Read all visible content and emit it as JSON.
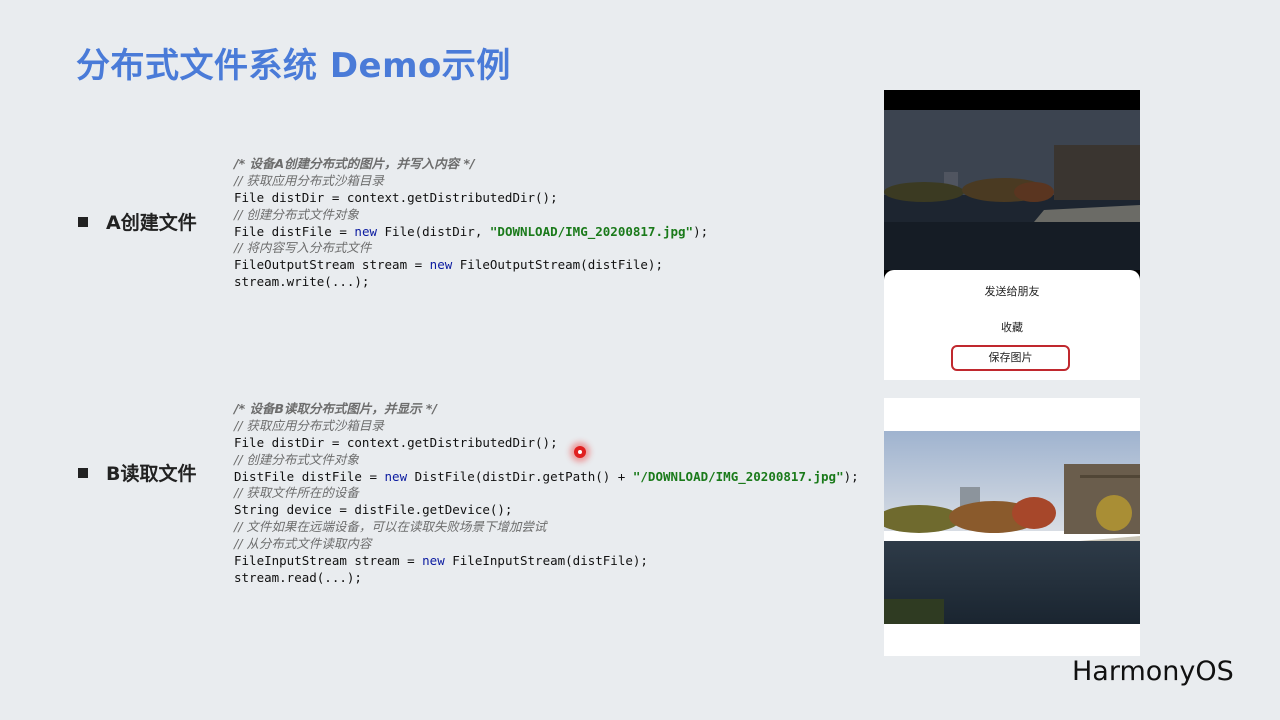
{
  "slide": {
    "title": "分布式文件系统 Demo示例",
    "logo": "HarmonyOS"
  },
  "section_a": {
    "label": "A创建文件",
    "code": [
      {
        "type": "comment-bold",
        "text": "/* 设备A创建分布式的图片，并写入内容 */"
      },
      {
        "type": "comment",
        "text": "// 获取应用分布式沙箱目录"
      },
      {
        "type": "code",
        "parts": [
          {
            "t": "File distDir = context.getDistributedDir();"
          }
        ]
      },
      {
        "type": "comment",
        "text": "// 创建分布式文件对象"
      },
      {
        "type": "code",
        "parts": [
          {
            "t": "File distFile = "
          },
          {
            "t": "new",
            "k": "kw"
          },
          {
            "t": " File(distDir, "
          },
          {
            "t": "\"DOWNLOAD/IMG_20200817.jpg\"",
            "k": "str"
          },
          {
            "t": ");"
          }
        ]
      },
      {
        "type": "comment",
        "text": "// 将内容写入分布式文件"
      },
      {
        "type": "code",
        "parts": [
          {
            "t": "FileOutputStream stream = "
          },
          {
            "t": "new",
            "k": "kw"
          },
          {
            "t": " FileOutputStream(distFile);"
          }
        ]
      },
      {
        "type": "code",
        "parts": [
          {
            "t": "stream.write(...);"
          }
        ]
      }
    ]
  },
  "section_b": {
    "label": "B读取文件",
    "code": [
      {
        "type": "comment-bold",
        "text": "/* 设备B读取分布式图片，并显示 */"
      },
      {
        "type": "comment",
        "text": "// 获取应用分布式沙箱目录"
      },
      {
        "type": "code",
        "parts": [
          {
            "t": "File distDir = context.getDistributedDir();"
          }
        ]
      },
      {
        "type": "comment",
        "text": "// 创建分布式文件对象"
      },
      {
        "type": "code",
        "parts": [
          {
            "t": "DistFile distFile = "
          },
          {
            "t": "new",
            "k": "kw"
          },
          {
            "t": " DistFile(distDir.getPath() + "
          },
          {
            "t": "\"/DOWNLOAD/IMG_20200817.jpg\"",
            "k": "str"
          },
          {
            "t": ");"
          }
        ]
      },
      {
        "type": "comment",
        "text": "// 获取文件所在的设备"
      },
      {
        "type": "code",
        "parts": [
          {
            "t": "String device = distFile.getDevice();"
          }
        ]
      },
      {
        "type": "comment",
        "text": "// 文件如果在远端设备，可以在读取失败场景下增加尝试"
      },
      {
        "type": "comment",
        "text": "// 从分布式文件读取内容"
      },
      {
        "type": "code",
        "parts": [
          {
            "t": "FileInputStream stream = "
          },
          {
            "t": "new",
            "k": "kw"
          },
          {
            "t": " FileInputStream(distFile);"
          }
        ]
      },
      {
        "type": "code",
        "parts": [
          {
            "t": "stream.read(...);"
          }
        ]
      }
    ]
  },
  "phone_a": {
    "menu": {
      "send_to_friend": "发送给朋友",
      "favorite": "收藏",
      "save_image": "保存图片"
    }
  },
  "colors": {
    "title": "#4a7bd8",
    "keyword": "#0a1aa0",
    "string": "#1a7a1a",
    "comment": "#6d6d6d",
    "highlight_border": "#c0282e"
  }
}
